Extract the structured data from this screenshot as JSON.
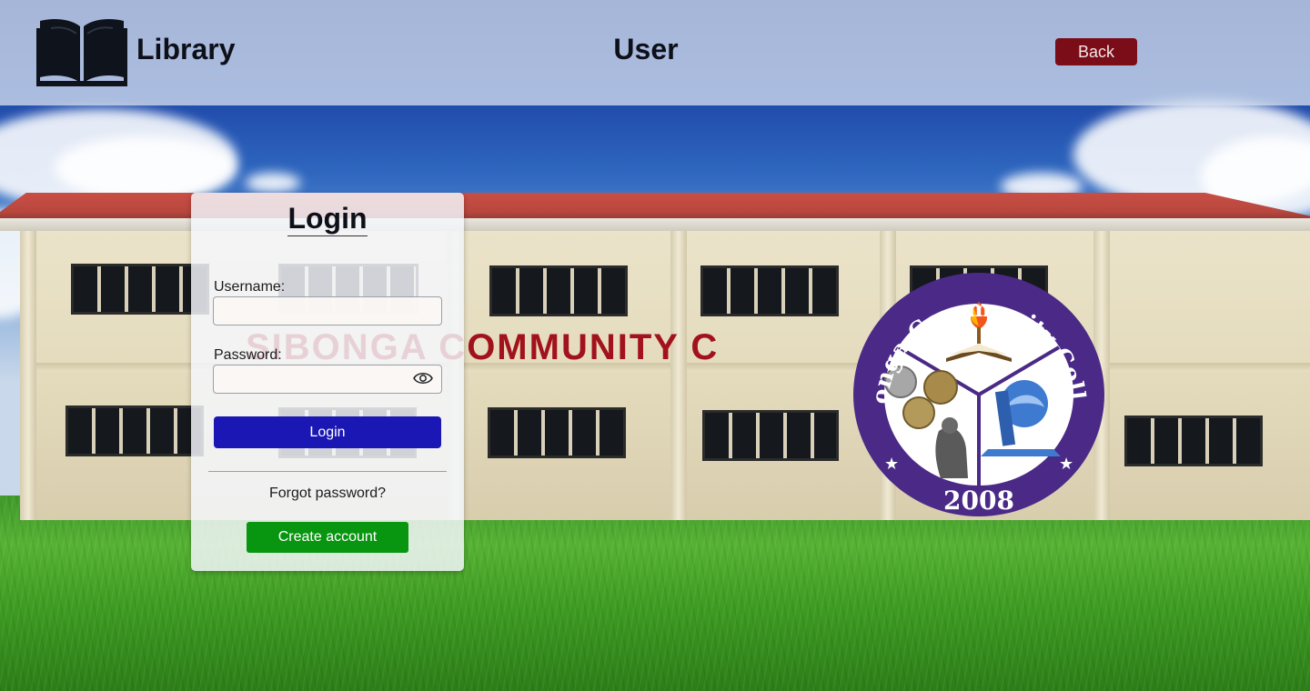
{
  "header": {
    "app_title": "Library",
    "page_title": "User",
    "back_label": "Back",
    "logo_icon": "open-book-icon"
  },
  "background": {
    "building_sign": "SIBONGA COMMUNITY C",
    "seal": {
      "arc_text": "Sibonga Community College",
      "year": "2008"
    }
  },
  "login": {
    "title": "Login",
    "username_label": "Username:",
    "username_value": "",
    "password_label": "Password:",
    "password_value": "",
    "show_password_icon": "eye-icon",
    "submit_label": "Login",
    "forgot_label": "Forgot password?",
    "create_label": "Create account"
  },
  "colors": {
    "back_button": "#7a0d17",
    "login_button": "#1a17b4",
    "create_button": "#089510",
    "seal_ring": "#4a2a86"
  }
}
